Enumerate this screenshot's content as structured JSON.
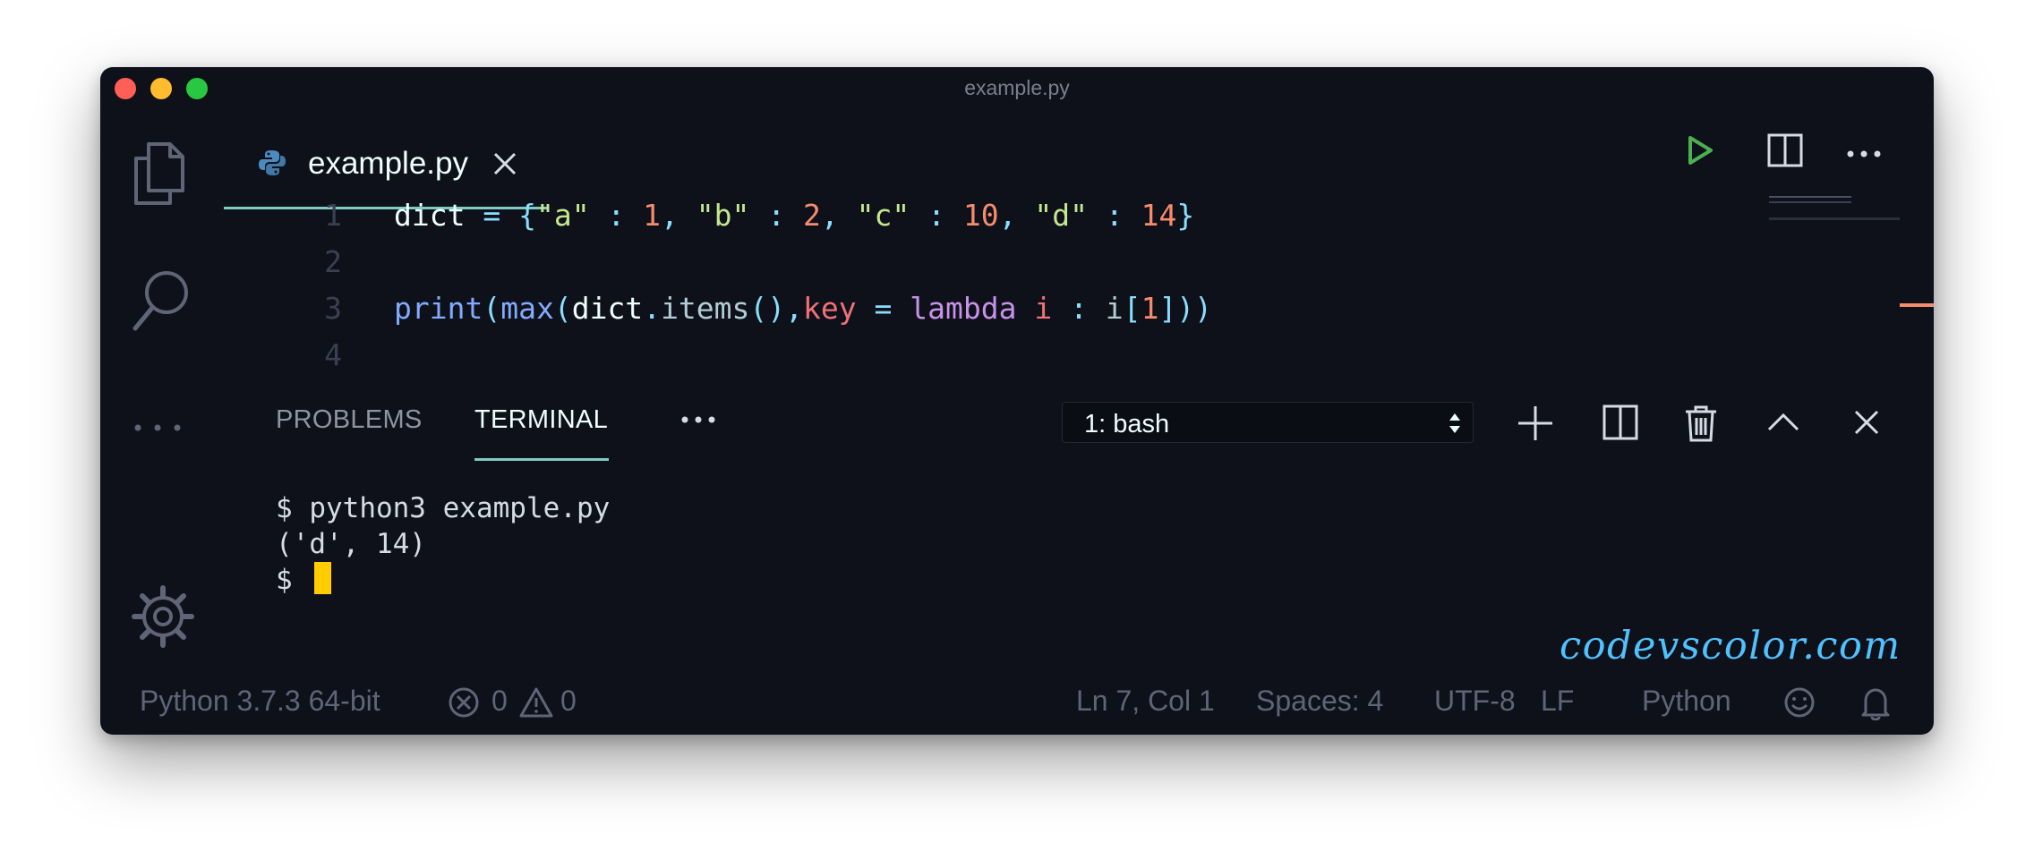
{
  "window": {
    "title": "example.py"
  },
  "activity_bar": {
    "icons": [
      "files-icon",
      "search-icon",
      "more-icon",
      "gear-icon"
    ]
  },
  "tab": {
    "label": "example.py",
    "icon": "python-icon"
  },
  "editor_actions": [
    "run-icon",
    "split-editor-icon",
    "more-actions-icon"
  ],
  "code_lines": [
    {
      "number": "1",
      "tokens": [
        [
          "plain",
          "dict "
        ],
        [
          "op",
          "= {"
        ],
        [
          "str",
          "\"a\""
        ],
        [
          "op",
          " : "
        ],
        [
          "num",
          "1"
        ],
        [
          "op",
          ", "
        ],
        [
          "str",
          "\"b\""
        ],
        [
          "op",
          " : "
        ],
        [
          "num",
          "2"
        ],
        [
          "op",
          ", "
        ],
        [
          "str",
          "\"c\""
        ],
        [
          "op",
          " : "
        ],
        [
          "num",
          "10"
        ],
        [
          "op",
          ", "
        ],
        [
          "str",
          "\"d\""
        ],
        [
          "op",
          " : "
        ],
        [
          "num",
          "14"
        ],
        [
          "op",
          "}"
        ]
      ]
    },
    {
      "number": "2",
      "tokens": []
    },
    {
      "number": "3",
      "tokens": [
        [
          "func",
          "print"
        ],
        [
          "op",
          "("
        ],
        [
          "func",
          "max"
        ],
        [
          "op",
          "("
        ],
        [
          "plain",
          "dict"
        ],
        [
          "op",
          "."
        ],
        [
          "prop",
          "items"
        ],
        [
          "op",
          "(),"
        ],
        [
          "key",
          "key"
        ],
        [
          "op",
          " = "
        ],
        [
          "kw",
          "lambda"
        ],
        [
          "plain",
          " "
        ],
        [
          "key",
          "i"
        ],
        [
          "op",
          " : "
        ],
        [
          "prop",
          "i"
        ],
        [
          "op",
          "["
        ],
        [
          "num",
          "1"
        ],
        [
          "op",
          "]))"
        ]
      ]
    },
    {
      "number": "4",
      "tokens": []
    }
  ],
  "panel": {
    "tabs": {
      "problems": "PROBLEMS",
      "terminal": "TERMINAL"
    },
    "terminal_select": "1: bash",
    "actions": [
      "plus-icon",
      "split-terminal-icon",
      "trash-icon",
      "chevron-up-icon",
      "close-panel-icon"
    ]
  },
  "terminal": {
    "line1": "$ python3 example.py",
    "line2": "('d', 14)",
    "prompt": "$ "
  },
  "watermark": "codevscolor.com",
  "status_bar": {
    "interpreter": "Python 3.7.3 64-bit",
    "errors": "0",
    "warnings": "0",
    "position": "Ln 7, Col 1",
    "spaces": "Spaces: 4",
    "encoding": "UTF-8",
    "eol": "LF",
    "language": "Python"
  },
  "colors": {
    "background": "#0f111a",
    "accent": "#80cbc4",
    "cursor": "#ffcc00"
  }
}
